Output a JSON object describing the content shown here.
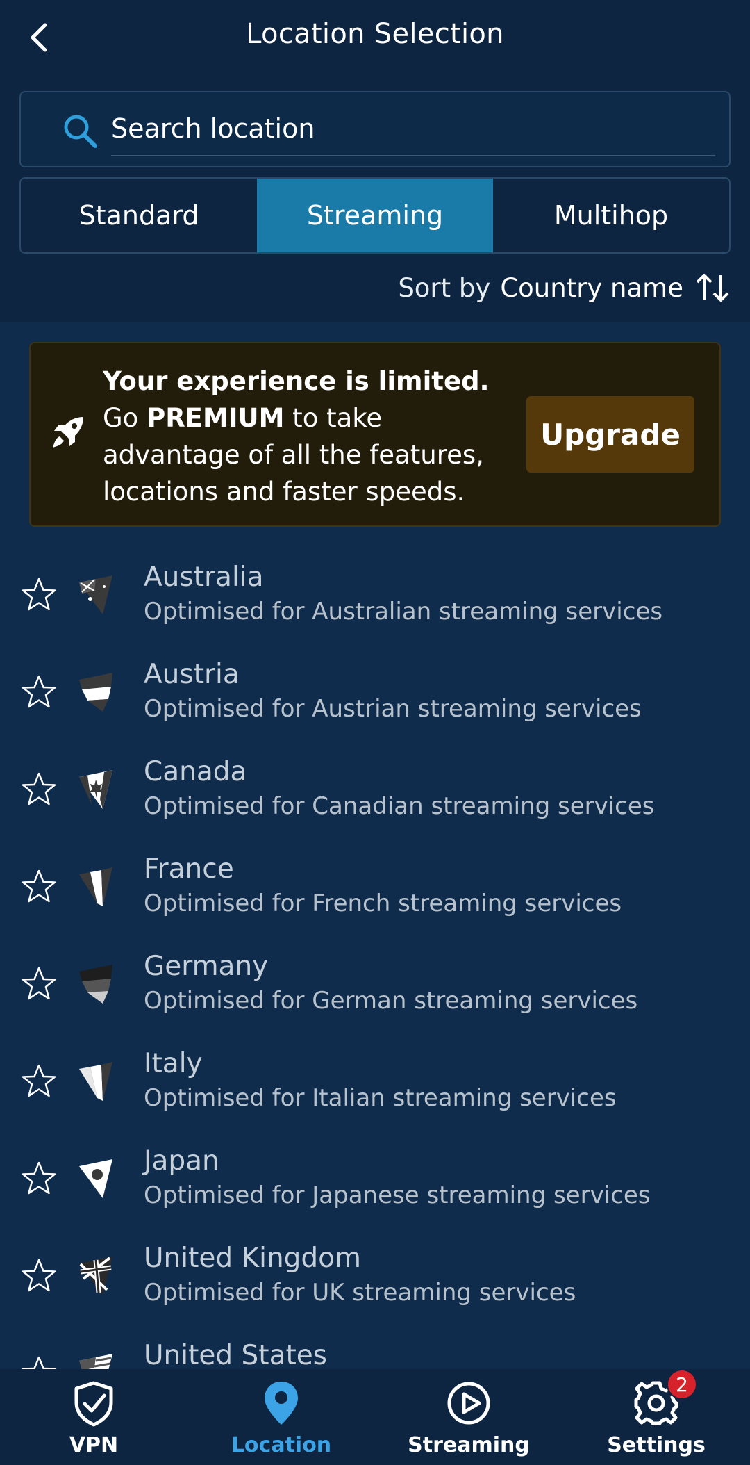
{
  "header": {
    "title": "Location Selection",
    "search": {
      "placeholder": "Search location",
      "value": ""
    },
    "tabs": [
      {
        "label": "Standard",
        "active": false
      },
      {
        "label": "Streaming",
        "active": true
      },
      {
        "label": "Multihop",
        "active": false
      }
    ],
    "sort": {
      "label": "Sort by",
      "value": "Country name"
    }
  },
  "banner": {
    "bold_lead": "Your experience is limited.",
    "text_1": " Go ",
    "premium": "PREMIUM",
    "text_2": " to take advantage of all the features, locations and faster speeds.",
    "button_label": "Upgrade"
  },
  "locations": [
    {
      "name": "Australia",
      "subtitle": "Optimised for Australian streaming services"
    },
    {
      "name": "Austria",
      "subtitle": "Optimised for Austrian streaming services"
    },
    {
      "name": "Canada",
      "subtitle": "Optimised for Canadian streaming services"
    },
    {
      "name": "France",
      "subtitle": "Optimised for French streaming services"
    },
    {
      "name": "Germany",
      "subtitle": "Optimised for German streaming services"
    },
    {
      "name": "Italy",
      "subtitle": "Optimised for Italian streaming services"
    },
    {
      "name": "Japan",
      "subtitle": "Optimised for Japanese streaming services"
    },
    {
      "name": "United Kingdom",
      "subtitle": "Optimised for UK streaming services"
    },
    {
      "name": "United States",
      "subtitle": ""
    }
  ],
  "nav": {
    "items": [
      {
        "label": "VPN",
        "icon": "shield-check-icon",
        "active": false
      },
      {
        "label": "Location",
        "icon": "location-pin-icon",
        "active": true
      },
      {
        "label": "Streaming",
        "icon": "play-circle-icon",
        "active": false
      },
      {
        "label": "Settings",
        "icon": "gear-icon",
        "active": false
      }
    ],
    "settings_badge": "2"
  },
  "colors": {
    "background": "#0f2c4d",
    "header": "#0d2540",
    "active_tab": "#1a7aa8",
    "accent": "#3ba3e6",
    "banner_bg": "#221c0a",
    "upgrade_button": "#55390a",
    "badge": "#d6232b"
  }
}
